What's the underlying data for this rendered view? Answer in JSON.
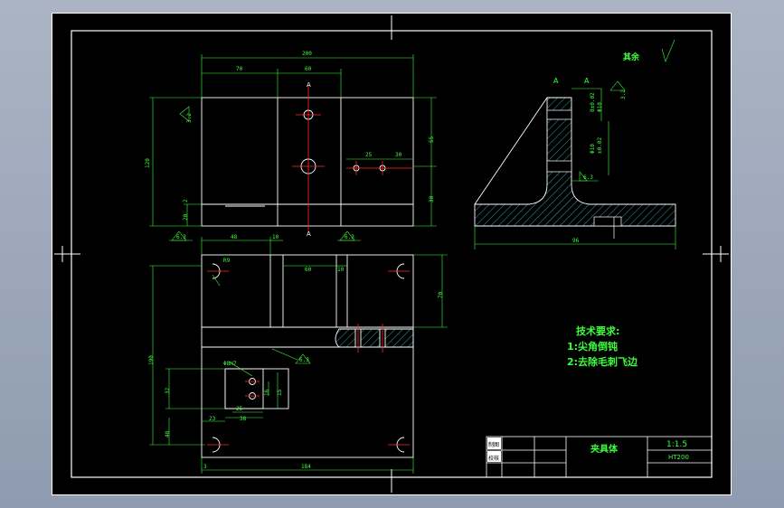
{
  "titleblock": {
    "part_name": "夹具体",
    "scale": "1:1.5",
    "material": "HT200",
    "row_draw": "制图",
    "row_check": "校核"
  },
  "tech": {
    "heading": "技术要求:",
    "items": [
      "1:尖角倒钝",
      "2:去除毛刺飞边"
    ]
  },
  "roughness_note": "其余",
  "section": {
    "label_a1": "A",
    "label_a2": "A",
    "rough1": "3.2",
    "rough2": "3.2"
  },
  "dims": {
    "top_overall": "200",
    "top_70": "70",
    "top_60": "60",
    "top_25": "25",
    "top_30": "30",
    "top_120": "120",
    "top_55": "55",
    "top_30r": "30",
    "top_2": "2",
    "top_20": "20",
    "rough_left": "3.2",
    "rough_bl": "6.3",
    "rough_bm": "6.3",
    "mid_48": "48",
    "mid_10a": "10",
    "mid_60": "60",
    "mid_10b": "10",
    "mid_70": "70",
    "mid_r": "R9",
    "mid_190": "190",
    "mid_32": "32",
    "mid_48b": "48",
    "mid_25": "25",
    "mid_23": "23",
    "mid_38": "38",
    "mid_16": "16",
    "mid_15": "15",
    "mid_3": "3",
    "mid_184": "184",
    "mid_rough": "6.3",
    "sec_dim1": "8±0.02",
    "sec_dim2": "Φ10",
    "sec_dim3": "Φ10",
    "sec_dim4": "±0.02",
    "sec_bottom": "96",
    "sec_rough": "6.3",
    "hole_note": "Φ8H7"
  }
}
